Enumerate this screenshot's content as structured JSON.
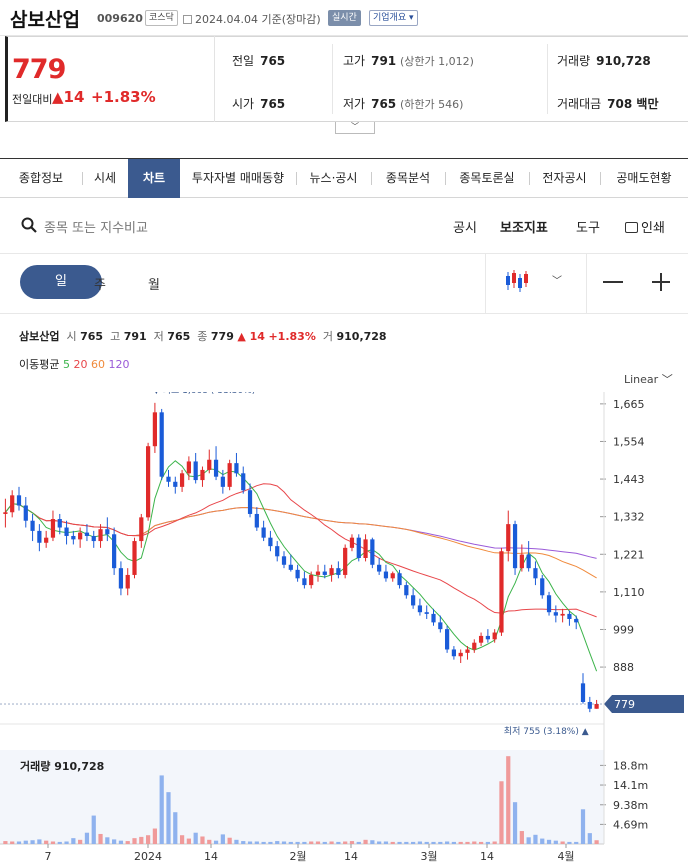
{
  "header": {
    "name": "삼보산업",
    "code": "009620",
    "market": "코스닥",
    "date": "2024.04.04 기준(장마감)",
    "realtime": "실시간",
    "company_info": "기업개요"
  },
  "quote": {
    "price": "779",
    "change_label": "전일대비",
    "change_symbol": "▲",
    "change": "14",
    "change_pct": "+1.83%",
    "prev_label": "전일",
    "prev": "765",
    "high_label": "고가",
    "high": "791",
    "upper_limit": "(상한가 1,012)",
    "volume_label": "거래량",
    "volume": "910,728",
    "open_label": "시가",
    "open": "765",
    "low_label": "저가",
    "low": "765",
    "lower_limit": "(하한가 546)",
    "amount_label": "거래대금",
    "amount": "708 백만"
  },
  "tabs": [
    "종합정보",
    "시세",
    "차트",
    "투자자별 매매동향",
    "뉴스·공시",
    "종목분석",
    "종목토론실",
    "전자공시",
    "공매도현황"
  ],
  "toolbar": {
    "search_placeholder": "종목 또는 지수비교",
    "disclosure": "공시",
    "indicator": "보조지표",
    "tools": "도구",
    "print": "인쇄"
  },
  "periods": {
    "day": "일",
    "week": "주",
    "month": "월"
  },
  "legend": {
    "name": "삼보산업",
    "open_l": "시",
    "open": "765",
    "high_l": "고",
    "high": "791",
    "low_l": "저",
    "low": "765",
    "close_l": "종",
    "close": "779",
    "chg": "▲ 14",
    "pct": "+1.83%",
    "vol_l": "거",
    "vol": "910,728",
    "ma_label": "이동평균",
    "ma": [
      "5",
      "20",
      "60",
      "120"
    ]
  },
  "scale_mode": "Linear",
  "colors": {
    "up": "#e02a2a",
    "down": "#1a5bd8",
    "ma5": "#3cb44b",
    "ma20": "#e8464a",
    "ma60": "#f08a3c",
    "ma120": "#9a5ad8",
    "accent": "#3b5a8f"
  },
  "chart_data": {
    "type": "candlestick",
    "y_ticks": [
      "1,665",
      "1,554",
      "1,443",
      "1,332",
      "1,221",
      "1,110",
      "999",
      "888"
    ],
    "ylim": [
      720,
      1700
    ],
    "x_ticks": [
      "7",
      "2024",
      "14",
      "2월",
      "14",
      "3월",
      "14",
      "4월"
    ],
    "current_price_label": "779",
    "max_label": "최고 1,668 (-53.30%)",
    "min_label": "최저 755 (3.18%)",
    "volume_label": "거래량 910,728",
    "volume_ticks": [
      "18.8m",
      "14.1m",
      "9.38m",
      "4.69m"
    ],
    "volume_ylim": [
      0,
      22000000
    ],
    "candles": [
      [
        1340,
        1385,
        1300,
        1345
      ],
      [
        1345,
        1410,
        1330,
        1395
      ],
      [
        1395,
        1420,
        1350,
        1365
      ],
      [
        1365,
        1390,
        1300,
        1320
      ],
      [
        1320,
        1340,
        1260,
        1290
      ],
      [
        1290,
        1310,
        1230,
        1255
      ],
      [
        1255,
        1290,
        1240,
        1270
      ],
      [
        1270,
        1350,
        1260,
        1325
      ],
      [
        1325,
        1340,
        1280,
        1300
      ],
      [
        1300,
        1320,
        1250,
        1275
      ],
      [
        1275,
        1290,
        1250,
        1265
      ],
      [
        1265,
        1300,
        1240,
        1285
      ],
      [
        1285,
        1310,
        1260,
        1275
      ],
      [
        1275,
        1290,
        1240,
        1260
      ],
      [
        1260,
        1310,
        1240,
        1295
      ],
      [
        1295,
        1330,
        1260,
        1280
      ],
      [
        1280,
        1300,
        1160,
        1180
      ],
      [
        1180,
        1200,
        1100,
        1120
      ],
      [
        1120,
        1180,
        1100,
        1160
      ],
      [
        1160,
        1270,
        1150,
        1260
      ],
      [
        1260,
        1340,
        1240,
        1330
      ],
      [
        1330,
        1550,
        1320,
        1540
      ],
      [
        1540,
        1668,
        1520,
        1640
      ],
      [
        1640,
        1650,
        1440,
        1450
      ],
      [
        1450,
        1470,
        1420,
        1435
      ],
      [
        1435,
        1450,
        1400,
        1420
      ],
      [
        1420,
        1470,
        1405,
        1460
      ],
      [
        1460,
        1510,
        1440,
        1495
      ],
      [
        1495,
        1520,
        1430,
        1440
      ],
      [
        1440,
        1480,
        1420,
        1470
      ],
      [
        1470,
        1530,
        1460,
        1500
      ],
      [
        1500,
        1540,
        1440,
        1450
      ],
      [
        1450,
        1470,
        1400,
        1420
      ],
      [
        1420,
        1500,
        1410,
        1490
      ],
      [
        1490,
        1520,
        1450,
        1460
      ],
      [
        1460,
        1480,
        1400,
        1410
      ],
      [
        1410,
        1430,
        1330,
        1340
      ],
      [
        1340,
        1360,
        1290,
        1300
      ],
      [
        1300,
        1320,
        1260,
        1270
      ],
      [
        1270,
        1290,
        1230,
        1245
      ],
      [
        1245,
        1260,
        1200,
        1215
      ],
      [
        1215,
        1230,
        1180,
        1190
      ],
      [
        1190,
        1220,
        1170,
        1175
      ],
      [
        1175,
        1190,
        1140,
        1150
      ],
      [
        1150,
        1170,
        1120,
        1130
      ],
      [
        1130,
        1170,
        1120,
        1160
      ],
      [
        1160,
        1190,
        1140,
        1170
      ],
      [
        1170,
        1190,
        1150,
        1160
      ],
      [
        1160,
        1190,
        1140,
        1180
      ],
      [
        1180,
        1200,
        1150,
        1160
      ],
      [
        1160,
        1250,
        1150,
        1240
      ],
      [
        1240,
        1280,
        1230,
        1270
      ],
      [
        1270,
        1280,
        1200,
        1210
      ],
      [
        1210,
        1280,
        1200,
        1265
      ],
      [
        1265,
        1270,
        1180,
        1190
      ],
      [
        1190,
        1210,
        1160,
        1170
      ],
      [
        1170,
        1190,
        1140,
        1150
      ],
      [
        1150,
        1170,
        1140,
        1165
      ],
      [
        1165,
        1175,
        1120,
        1130
      ],
      [
        1130,
        1140,
        1090,
        1100
      ],
      [
        1100,
        1120,
        1060,
        1070
      ],
      [
        1070,
        1090,
        1040,
        1050
      ],
      [
        1050,
        1070,
        1030,
        1045
      ],
      [
        1045,
        1060,
        1010,
        1020
      ],
      [
        1020,
        1040,
        990,
        1000
      ],
      [
        1000,
        1010,
        930,
        940
      ],
      [
        940,
        950,
        910,
        920
      ],
      [
        920,
        940,
        900,
        930
      ],
      [
        930,
        950,
        910,
        940
      ],
      [
        940,
        970,
        930,
        960
      ],
      [
        960,
        990,
        950,
        980
      ],
      [
        980,
        1000,
        960,
        970
      ],
      [
        970,
        1000,
        960,
        990
      ],
      [
        990,
        1240,
        980,
        1230
      ],
      [
        1230,
        1350,
        1200,
        1310
      ],
      [
        1310,
        1320,
        1160,
        1180
      ],
      [
        1180,
        1250,
        1170,
        1220
      ],
      [
        1220,
        1260,
        1170,
        1180
      ],
      [
        1180,
        1200,
        1130,
        1150
      ],
      [
        1150,
        1160,
        1090,
        1100
      ],
      [
        1100,
        1110,
        1040,
        1050
      ],
      [
        1050,
        1070,
        1020,
        1040
      ],
      [
        1040,
        1060,
        1020,
        1045
      ],
      [
        1045,
        1055,
        1010,
        1030
      ],
      [
        1030,
        1040,
        1000,
        1020
      ],
      [
        840,
        870,
        780,
        785
      ],
      [
        785,
        800,
        755,
        765
      ],
      [
        765,
        791,
        765,
        779
      ]
    ],
    "volumes": [
      0.7,
      0.6,
      0.6,
      0.8,
      0.9,
      1.1,
      0.8,
      0.6,
      0.5,
      0.6,
      1.4,
      1.0,
      2.7,
      6.8,
      2.4,
      1.6,
      1.1,
      0.8,
      0.7,
      1.4,
      1.7,
      2.1,
      3.7,
      16.4,
      12.4,
      7.6,
      2.1,
      1.3,
      2.7,
      1.8,
      1.0,
      0.8,
      2.3,
      1.5,
      1.0,
      0.7,
      0.6,
      0.6,
      0.5,
      0.5,
      0.7,
      0.6,
      0.5,
      0.5,
      0.5,
      0.6,
      0.6,
      0.5,
      0.6,
      0.5,
      0.6,
      0.7,
      0.5,
      1.0,
      0.9,
      0.6,
      0.6,
      0.5,
      0.5,
      0.5,
      0.5,
      0.6,
      0.5,
      0.5,
      0.5,
      0.6,
      0.5,
      0.5,
      0.5,
      0.6,
      0.5,
      0.5,
      0.6,
      15.0,
      21.0,
      10.0,
      3.1,
      1.6,
      2.2,
      1.3,
      1.0,
      0.8,
      0.6,
      0.5,
      0.5,
      8.3,
      2.6,
      0.9
    ]
  }
}
